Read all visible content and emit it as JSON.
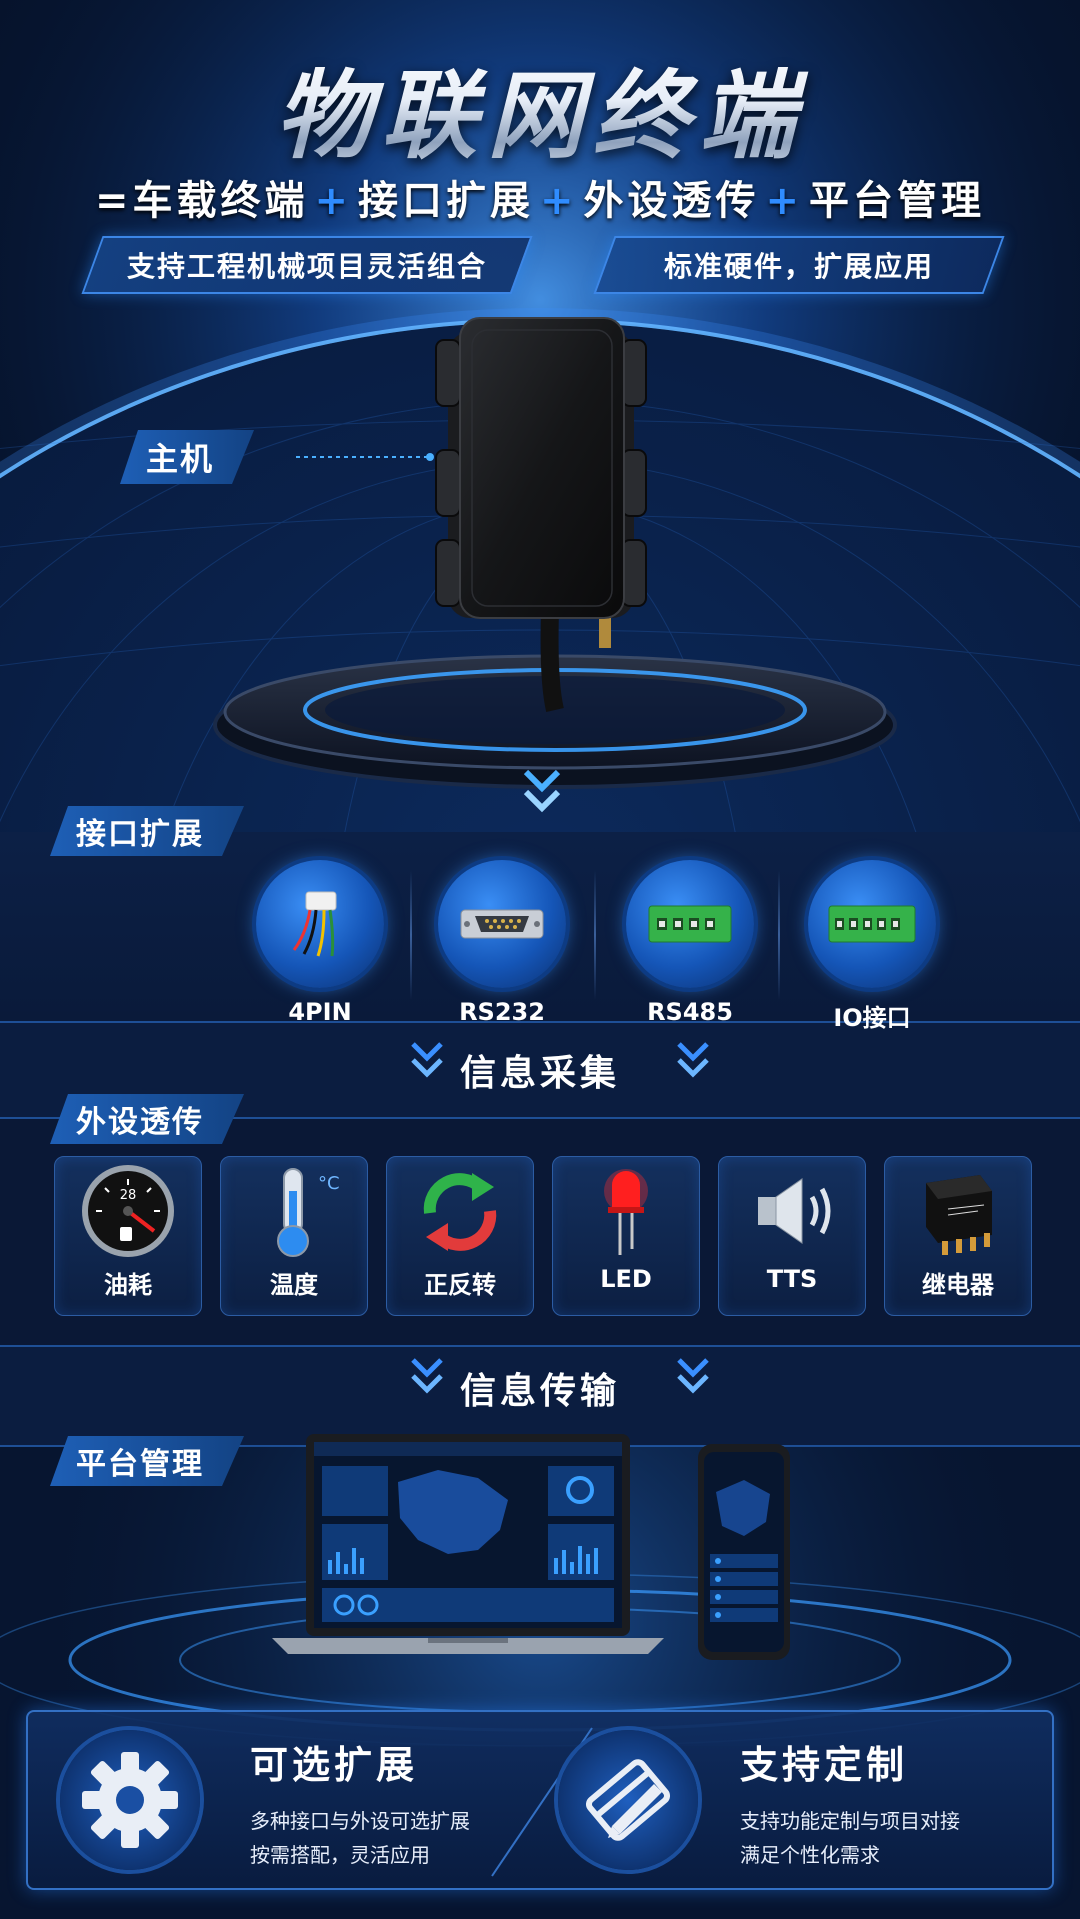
{
  "header": {
    "title": "物联网终端",
    "subtitle_prefix": "=车载终端",
    "subtitle_parts": [
      "接口扩展",
      "外设透传",
      "平台管理"
    ],
    "plus_symbol": "+",
    "tags": [
      "支持工程机械项目灵活组合",
      "标准硬件，扩展应用"
    ]
  },
  "host": {
    "label": "主机"
  },
  "interfaces": {
    "label": "接口扩展",
    "items": [
      {
        "label": "4PIN",
        "icon": "4pin-connector-icon"
      },
      {
        "label": "RS232",
        "icon": "db9-serial-port-icon"
      },
      {
        "label": "RS485",
        "icon": "green-terminal-block-icon"
      },
      {
        "label": "IO接口",
        "icon": "green-terminal-block-icon"
      }
    ]
  },
  "info_collect": {
    "heading": "信息采集"
  },
  "peripherals": {
    "label": "外设透传",
    "items": [
      {
        "label": "油耗",
        "icon": "fuel-gauge-icon",
        "gauge_value": "28"
      },
      {
        "label": "温度",
        "icon": "thermometer-icon",
        "unit": "°C"
      },
      {
        "label": "正反转",
        "icon": "rotation-arrows-icon"
      },
      {
        "label": "LED",
        "icon": "red-led-icon"
      },
      {
        "label": "TTS",
        "icon": "speaker-icon"
      },
      {
        "label": "继电器",
        "icon": "relay-icon"
      }
    ]
  },
  "info_transfer": {
    "heading": "信息传输"
  },
  "platform": {
    "label": "平台管理"
  },
  "features": [
    {
      "title": "可选扩展",
      "lines": [
        "多种接口与外设可选扩展",
        "按需搭配，灵活应用"
      ],
      "icon": "gear-icon"
    },
    {
      "title": "支持定制",
      "lines": [
        "支持功能定制与项目对接",
        "满足个性化需求"
      ],
      "icon": "custom-card-icon"
    }
  ],
  "colors": {
    "accent": "#2f8cff",
    "background": "#06132c",
    "panel": "#1e5fb6"
  }
}
